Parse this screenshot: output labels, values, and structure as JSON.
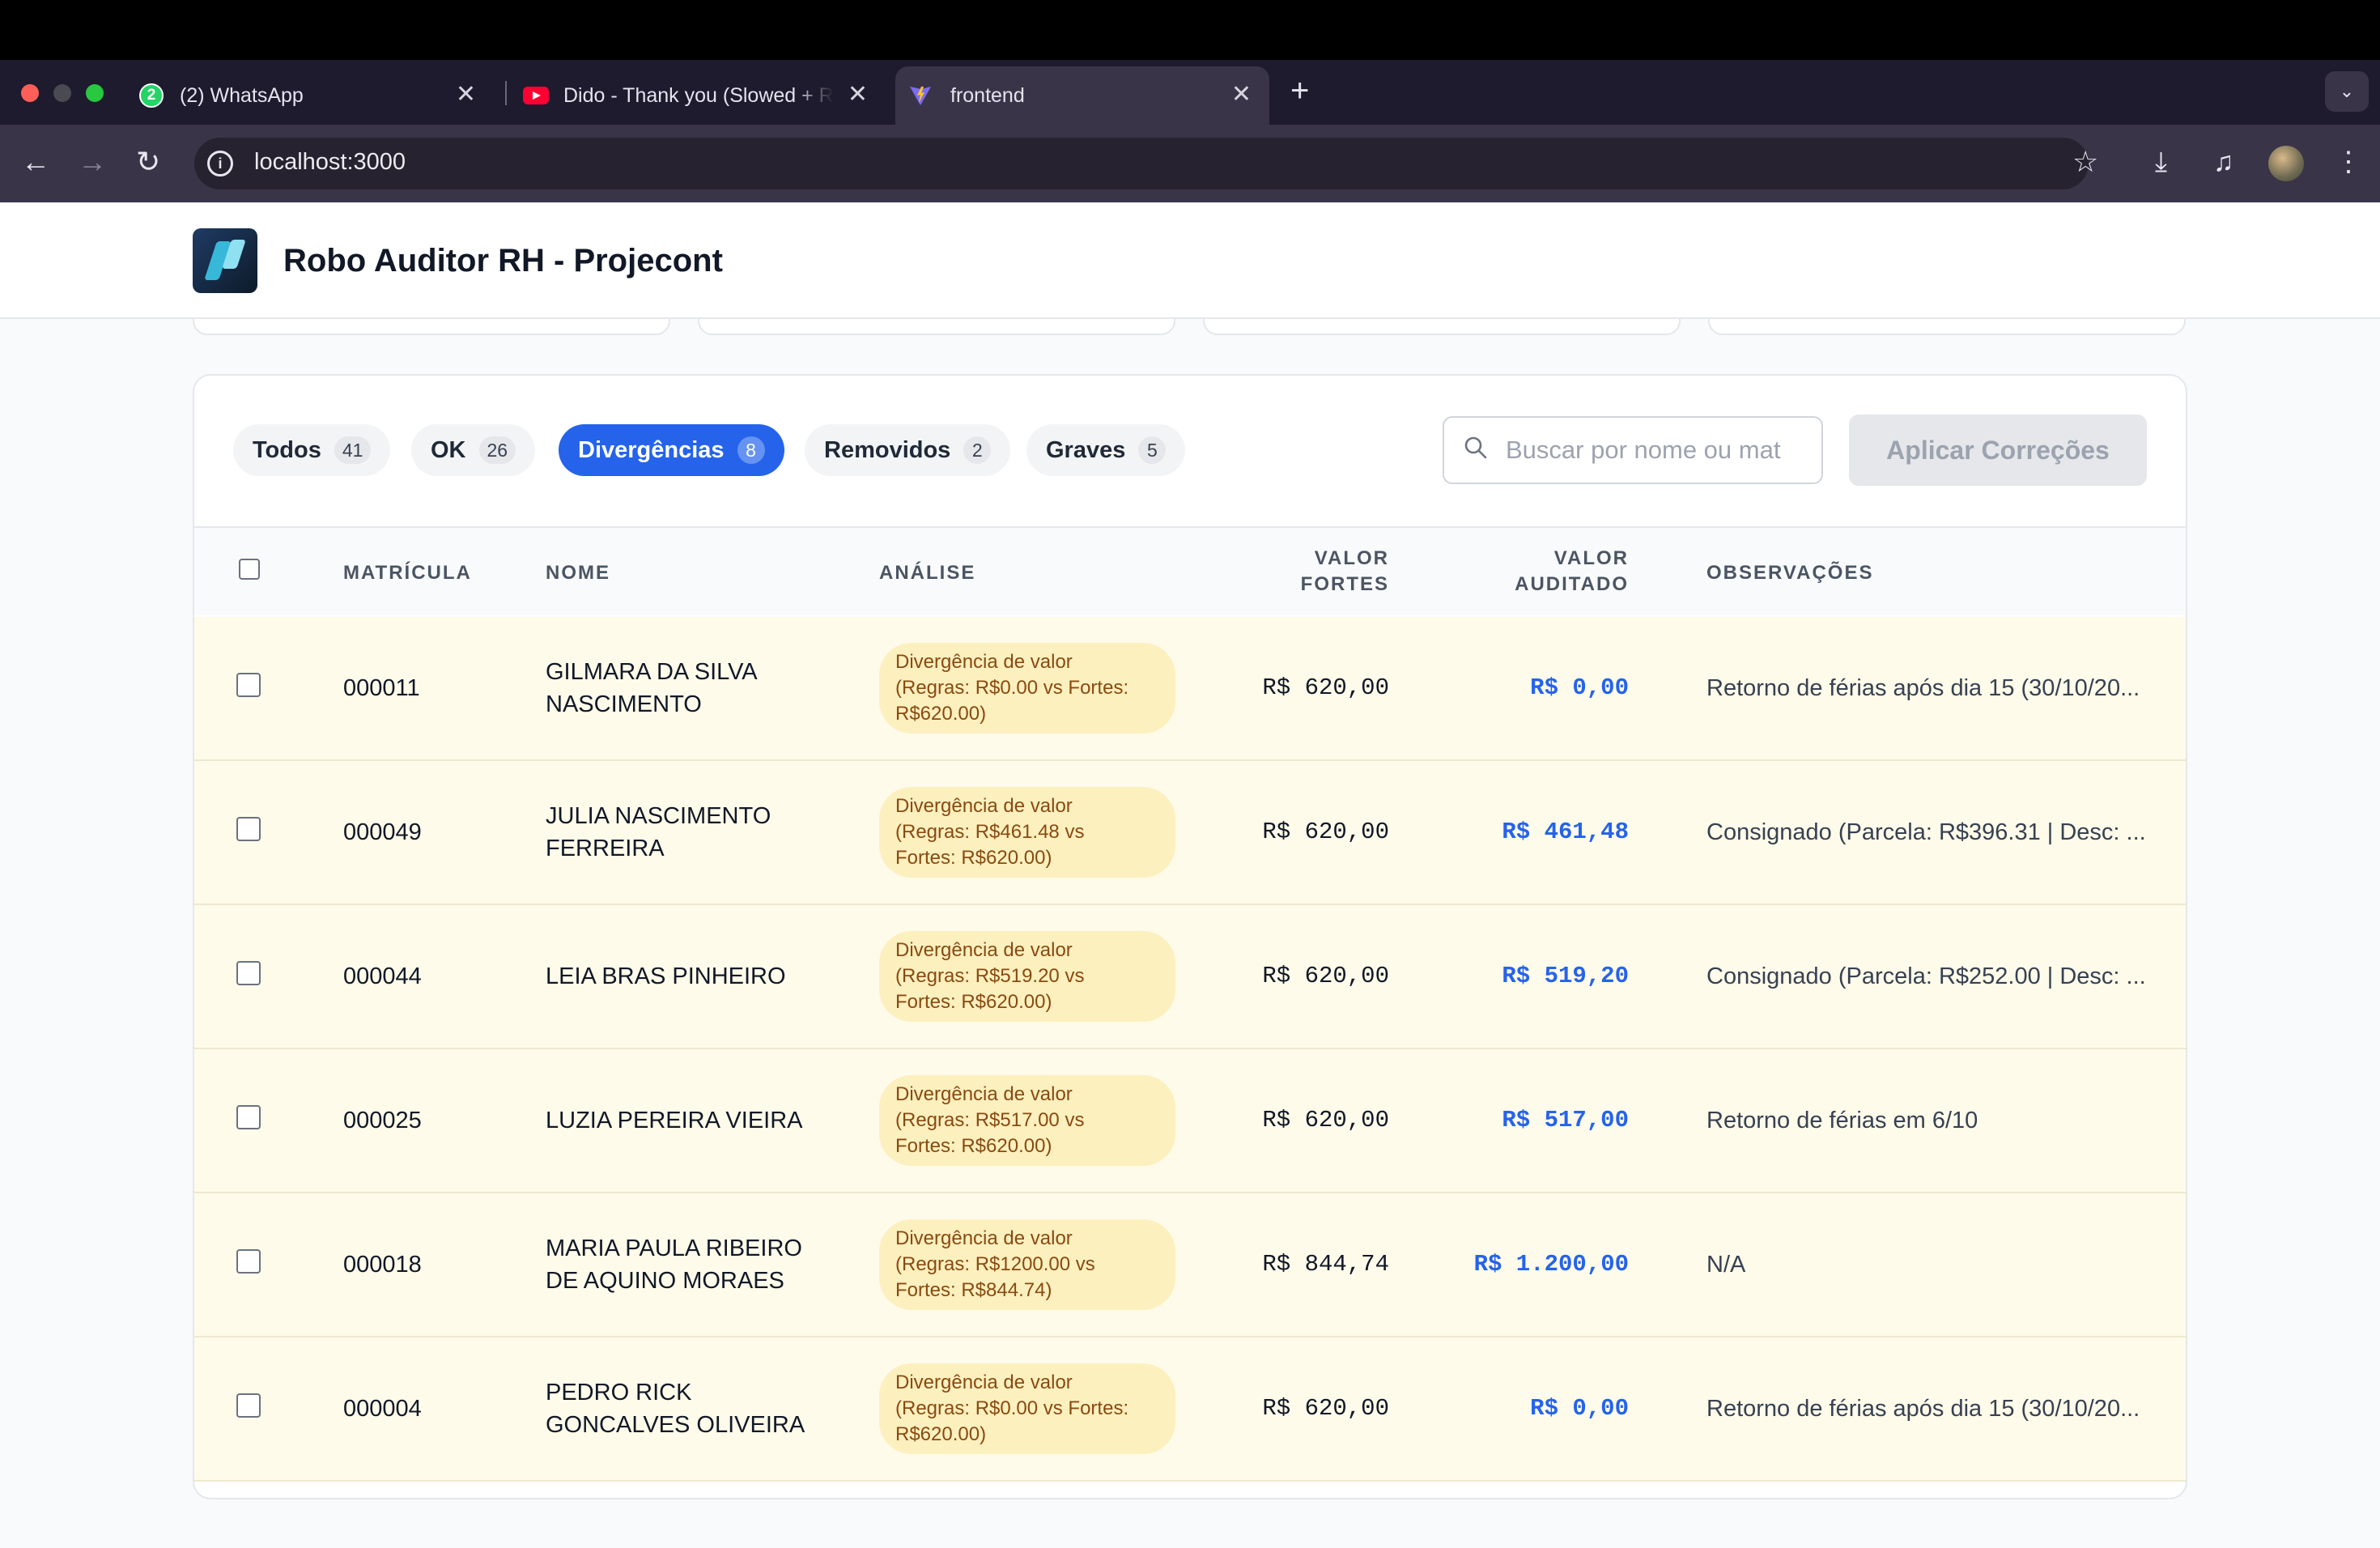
{
  "browser": {
    "tabs": [
      {
        "title": "(2) WhatsApp",
        "badge": "2",
        "icon": "whatsapp-icon"
      },
      {
        "title": "Dido - Thank you (Slowed + R",
        "icon": "youtube-icon"
      },
      {
        "title": "frontend",
        "icon": "vite-icon",
        "active": true
      }
    ],
    "url": "localhost:3000"
  },
  "app": {
    "title": "Robo Auditor RH - Projecont"
  },
  "filters": [
    {
      "label": "Todos",
      "count": "41"
    },
    {
      "label": "OK",
      "count": "26"
    },
    {
      "label": "Divergências",
      "count": "8",
      "active": true
    },
    {
      "label": "Removidos",
      "count": "2"
    },
    {
      "label": "Graves",
      "count": "5"
    }
  ],
  "search": {
    "placeholder": "Buscar por nome ou mat"
  },
  "apply_button": "Aplicar Correções",
  "table": {
    "headers": {
      "matricula": "MATRÍCULA",
      "nome": "NOME",
      "analise": "ANÁLISE",
      "valor_fortes_1": "VALOR",
      "valor_fortes_2": "FORTES",
      "valor_auditado_1": "VALOR",
      "valor_auditado_2": "AUDITADO",
      "observacoes": "OBSERVAÇÕES"
    },
    "rows": [
      {
        "matricula": "000011",
        "nome_1": "GILMARA DA SILVA",
        "nome_2": "NASCIMENTO",
        "analise_1": "Divergência de valor",
        "analise_2": "(Regras: R$0.00 vs Fortes:",
        "analise_3": "R$620.00)",
        "valor_fortes": "R$ 620,00",
        "valor_auditado": "R$ 0,00",
        "obs": "Retorno de férias após dia 15 (30/10/20..."
      },
      {
        "matricula": "000049",
        "nome_1": "JULIA NASCIMENTO",
        "nome_2": "FERREIRA",
        "analise_1": "Divergência de valor",
        "analise_2": "(Regras: R$461.48 vs",
        "analise_3": "Fortes: R$620.00)",
        "valor_fortes": "R$ 620,00",
        "valor_auditado": "R$ 461,48",
        "obs": "Consignado (Parcela: R$396.31 | Desc: ..."
      },
      {
        "matricula": "000044",
        "nome_1": "LEIA BRAS PINHEIRO",
        "nome_2": "",
        "analise_1": "Divergência de valor",
        "analise_2": "(Regras: R$519.20 vs",
        "analise_3": "Fortes: R$620.00)",
        "valor_fortes": "R$ 620,00",
        "valor_auditado": "R$ 519,20",
        "obs": "Consignado (Parcela: R$252.00 | Desc: ..."
      },
      {
        "matricula": "000025",
        "nome_1": "LUZIA PEREIRA VIEIRA",
        "nome_2": "",
        "analise_1": "Divergência de valor",
        "analise_2": "(Regras: R$517.00 vs",
        "analise_3": "Fortes: R$620.00)",
        "valor_fortes": "R$ 620,00",
        "valor_auditado": "R$ 517,00",
        "obs": "Retorno de férias em 6/10"
      },
      {
        "matricula": "000018",
        "nome_1": "MARIA PAULA RIBEIRO",
        "nome_2": "DE AQUINO MORAES",
        "analise_1": "Divergência de valor",
        "analise_2": "(Regras: R$1200.00 vs",
        "analise_3": "Fortes: R$844.74)",
        "valor_fortes": "R$ 844,74",
        "valor_auditado": "R$ 1.200,00",
        "obs": "N/A"
      },
      {
        "matricula": "000004",
        "nome_1": "PEDRO RICK",
        "nome_2": "GONCALVES OLIVEIRA",
        "analise_1": "Divergência de valor",
        "analise_2": "(Regras: R$0.00 vs Fortes:",
        "analise_3": "R$620.00)",
        "valor_fortes": "R$ 620,00",
        "valor_auditado": "R$ 0,00",
        "obs": "Retorno de férias após dia 15 (30/10/20..."
      }
    ]
  },
  "colors": {
    "accent": "#2563eb",
    "row_highlight": "#fefbea",
    "badge_bg": "#fdf0bf",
    "badge_text": "#8a4a10"
  }
}
